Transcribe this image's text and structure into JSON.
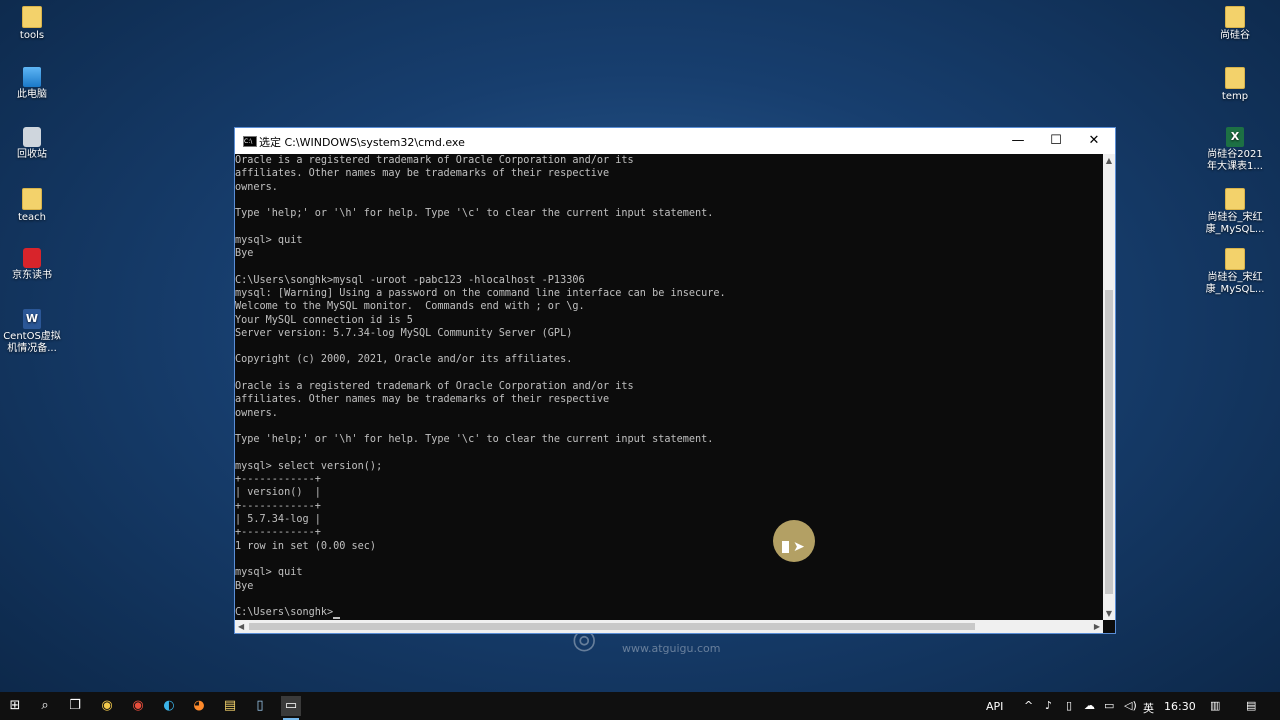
{
  "desktop": {
    "left_icons": [
      {
        "label": "tools",
        "icon": "folder-icon"
      },
      {
        "label": "此电脑",
        "icon": "computer-icon"
      },
      {
        "label": "回收站",
        "icon": "recycle-bin-icon"
      },
      {
        "label": "teach",
        "icon": "folder-icon"
      },
      {
        "label": "京东读书",
        "icon": "app-icon"
      },
      {
        "label": "CentOS虚拟机情况备...",
        "icon": "word-doc-icon"
      }
    ],
    "right_icons": [
      {
        "label": "尚硅谷",
        "icon": "folder-icon"
      },
      {
        "label": "temp",
        "icon": "folder-icon"
      },
      {
        "label": "尚硅谷2021年大课表1...",
        "icon": "excel-doc-icon"
      },
      {
        "label": "尚硅谷_宋红康_MySQL...",
        "icon": "folder-icon"
      },
      {
        "label": "尚硅谷_宋红康_MySQL...",
        "icon": "folder-icon"
      }
    ],
    "watermark_url": "www.atguigu.com"
  },
  "window": {
    "title": "选定 C:\\WINDOWS\\system32\\cmd.exe",
    "minimize_glyph": "—",
    "maximize_glyph": "☐",
    "close_glyph": "✕"
  },
  "console": {
    "lines": [
      "Oracle is a registered trademark of Oracle Corporation and/or its",
      "affiliates. Other names may be trademarks of their respective",
      "owners.",
      "",
      "Type 'help;' or '\\h' for help. Type '\\c' to clear the current input statement.",
      "",
      "mysql> quit",
      "Bye",
      "",
      "C:\\Users\\songhk>mysql -uroot -pabc123 -hlocalhost -P13306",
      "mysql: [Warning] Using a password on the command line interface can be insecure.",
      "Welcome to the MySQL monitor.  Commands end with ; or \\g.",
      "Your MySQL connection id is 5",
      "Server version: 5.7.34-log MySQL Community Server (GPL)",
      "",
      "Copyright (c) 2000, 2021, Oracle and/or its affiliates.",
      "",
      "Oracle is a registered trademark of Oracle Corporation and/or its",
      "affiliates. Other names may be trademarks of their respective",
      "owners.",
      "",
      "Type 'help;' or '\\h' for help. Type '\\c' to clear the current input statement.",
      "",
      "mysql> select version();",
      "+------------+",
      "| version()  |",
      "+------------+",
      "| 5.7.34-log |",
      "+------------+",
      "1 row in set (0.00 sec)",
      "",
      "mysql> quit",
      "Bye",
      ""
    ],
    "prompt": "C:\\Users\\songhk>"
  },
  "taskbar": {
    "items": [
      {
        "name": "start-icon",
        "glyph": "⊞"
      },
      {
        "name": "search-icon",
        "glyph": "⌕"
      },
      {
        "name": "task-view-icon",
        "glyph": "❐"
      },
      {
        "name": "chrome-icon",
        "glyph": "◉"
      },
      {
        "name": "chrome-alt-icon",
        "glyph": "◉"
      },
      {
        "name": "edge-icon",
        "glyph": "◐"
      },
      {
        "name": "firefox-icon",
        "glyph": "◕"
      },
      {
        "name": "file-explorer-icon",
        "glyph": "▤"
      },
      {
        "name": "notepad-icon",
        "glyph": "▯"
      },
      {
        "name": "cmd-icon",
        "glyph": "▭"
      }
    ],
    "tray_api": "API",
    "tray_lang": "英",
    "clock": "16:30",
    "chevron_glyph": "^"
  },
  "colors": {
    "console_text": "#c0c0c0",
    "console_bg": "#0c0c0c",
    "accent": "#76b9ed"
  }
}
